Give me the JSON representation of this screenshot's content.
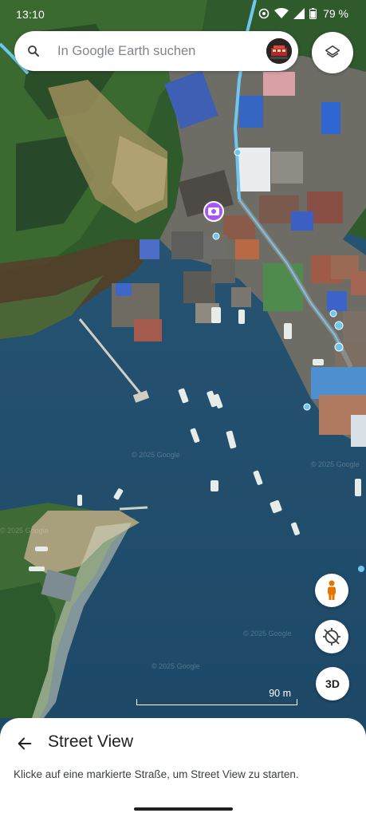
{
  "status_bar": {
    "time": "13:10",
    "battery": "79 %",
    "icons": [
      "sync-icon",
      "wifi-icon",
      "signal-icon",
      "battery-icon"
    ]
  },
  "search": {
    "placeholder": "In Google Earth suchen",
    "icon": "search-icon"
  },
  "controls": {
    "layers_icon": "layers-icon",
    "pegman_icon": "pegman-icon",
    "location_icon": "location-off-icon",
    "three_d_label": "3D"
  },
  "map": {
    "scale_label": "90 m",
    "watermarks": [
      "© 2025 Google",
      "© 2025 Google",
      "© 2025 Google",
      "© 2025 Google",
      "© 2025 Google"
    ],
    "accent_colors": {
      "water": "#1f4d6b",
      "street_view_lines": "#6fc6ee",
      "photo_marker": "#a855f7"
    }
  },
  "sheet": {
    "title": "Street View",
    "description": "Klicke auf eine markierte Straße, um Street View zu starten."
  }
}
